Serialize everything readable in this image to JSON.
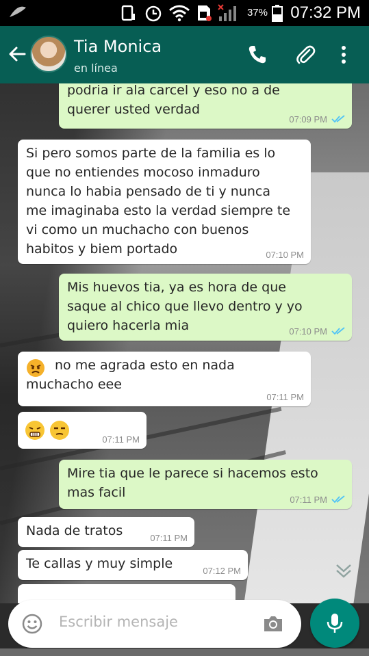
{
  "status_bar": {
    "battery_percent": "37%",
    "time": "07:32 PM"
  },
  "header": {
    "contact_name": "Tia Monica",
    "contact_status": "en línea",
    "icons": [
      "back-arrow-icon",
      "avatar",
      "phone-icon",
      "attach-icon",
      "more-icon"
    ]
  },
  "messages": [
    {
      "dir": "out",
      "text": "podria ir ala carcel y eso no a de\nquerer usted verdad",
      "time": "07:09 PM",
      "ticks": "read"
    },
    {
      "dir": "in",
      "text": "Si pero somos parte de la familia es lo\nque no entiendes mocoso inmaduro\nnunca lo habia pensado de ti y nunca\nme imaginaba esto la verdad siempre te\nvi como un muchacho con buenos\nhabitos y biem portado",
      "time": "07:10 PM"
    },
    {
      "dir": "out",
      "text": "Mis huevos tia, ya es hora de que\nsaque al chico que llevo dentro y yo\nquiero hacerla mia",
      "time": "07:10 PM",
      "ticks": "read"
    },
    {
      "dir": "in",
      "text": "no me agrada esto en nada\nmuchacho eee",
      "time": "07:11 PM",
      "emoji": "angry-face"
    },
    {
      "dir": "in",
      "text": "",
      "time": "07:11 PM",
      "emoji": "steam-face unamused-face"
    },
    {
      "dir": "out",
      "text": "Mire tia que le parece si hacemos esto\nmas facil",
      "time": "07:11 PM",
      "ticks": "read"
    },
    {
      "dir": "in",
      "text": "Nada de tratos",
      "time": "07:11 PM"
    },
    {
      "dir": "in",
      "text": "Te callas y muy simple",
      "time": "07:12 PM"
    }
  ],
  "input": {
    "placeholder": "Escribir mensaje"
  },
  "colors": {
    "header": "#075e54",
    "outgoing_bubble": "#dcf8c6",
    "incoming_bubble": "#ffffff",
    "read_ticks": "#4fc3f7",
    "mic_button": "#00897b"
  }
}
